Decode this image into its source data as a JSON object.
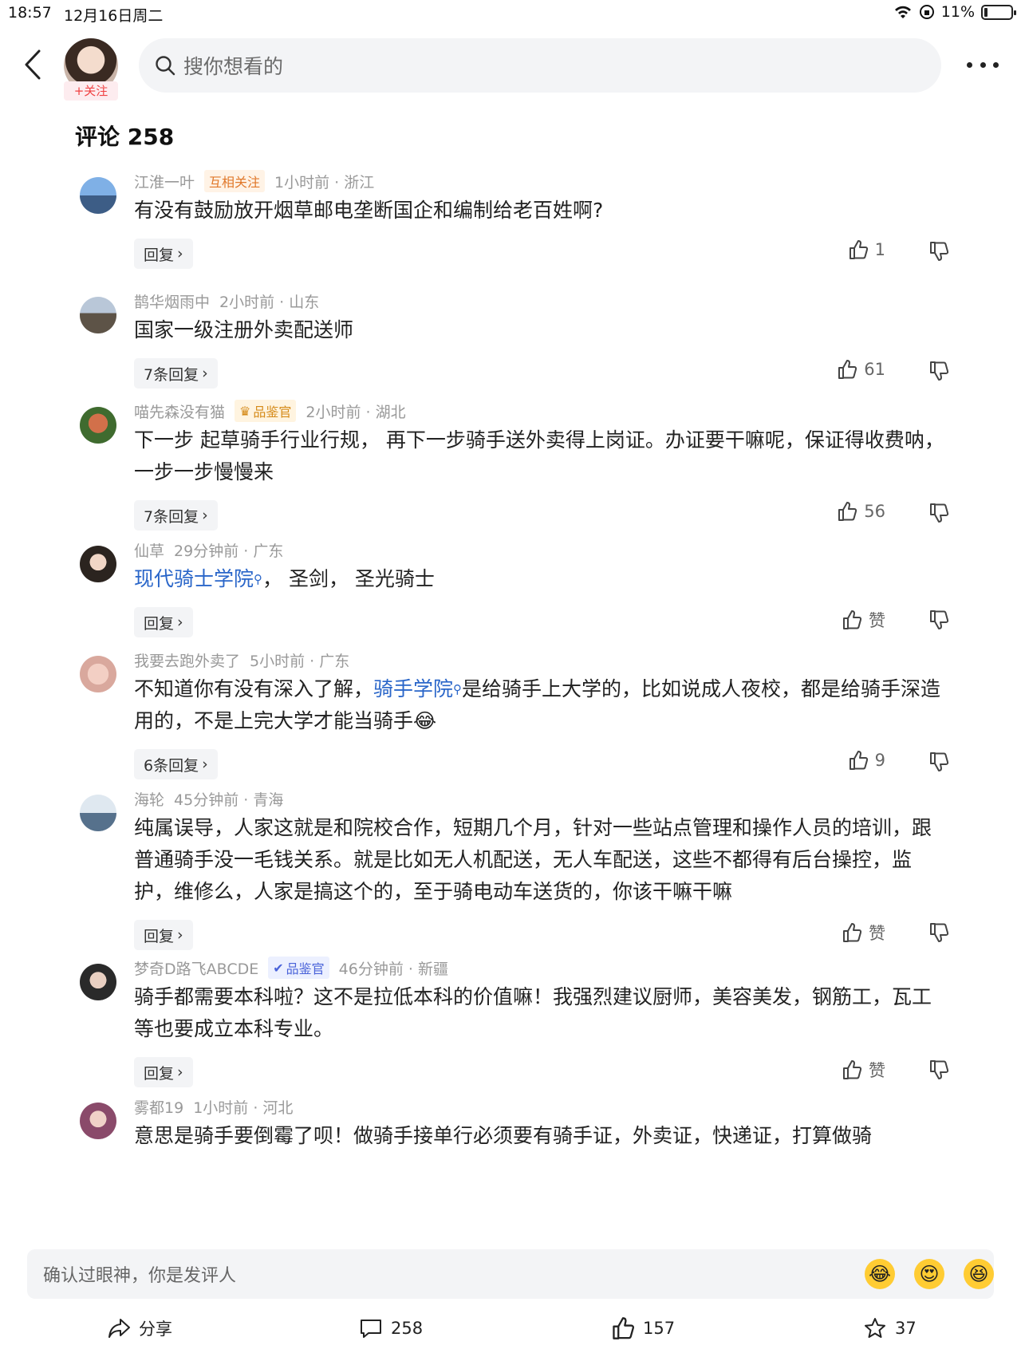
{
  "status": {
    "time": "18:57",
    "date": "12月16日周二",
    "battery": "11%",
    "battery_level": 0.11
  },
  "header": {
    "follow_label": "+关注",
    "search_placeholder": "搜你想看的"
  },
  "comments_title": "评论 258",
  "comments": [
    {
      "user": "江淮一叶",
      "badge": "互相关注",
      "time": "1小时前",
      "loc": "浙江",
      "text": "有没有鼓励放开烟草邮电垄断国企和编制给老百姓啊?",
      "reply": "回复",
      "likes": "1",
      "avatar_color": "#5b86c4"
    },
    {
      "user": "鹊华烟雨中",
      "time": "2小时前",
      "loc": "山东",
      "text": "国家一级注册外卖配送师",
      "reply": "7条回复",
      "likes": "61",
      "avatar_color": "#7d8a9a"
    },
    {
      "user": "喵先森没有猫",
      "badge": "品鉴官",
      "time": "2小时前",
      "loc": "湖北",
      "text": "下一步 起草骑手行业行规， 再下一步骑手送外卖得上岗证。办证要干嘛呢，保证得收费呐， 一步一步慢慢来",
      "reply": "7条回复",
      "likes": "56",
      "avatar_color": "#c98a5a"
    },
    {
      "user": "仙草",
      "time": "29分钟前",
      "loc": "广东",
      "link": "现代骑士学院",
      "text_after": "， 圣剑， 圣光骑士",
      "reply": "回复",
      "likes": "赞",
      "avatar_color": "#3a332c"
    },
    {
      "user": "我要去跑外卖了",
      "time": "5小时前",
      "loc": "广东",
      "text_before": "不知道你有没有深入了解，",
      "link": "骑手学院",
      "text_after": "是给骑手上大学的，比如说成人夜校，都是给骑手深造用的，不是上完大学才能当骑手😂",
      "reply": "6条回复",
      "likes": "9",
      "avatar_color": "#e8c8c0"
    },
    {
      "user": "海轮",
      "time": "45分钟前",
      "loc": "青海",
      "text": "纯属误导，人家这就是和院校合作，短期几个月，针对一些站点管理和操作人员的培训，跟普通骑手没一毛钱关系。就是比如无人机配送，无人车配送，这些不都得有后台操控，监护，维修么，人家是搞这个的，至于骑电动车送货的，你该干嘛干嘛",
      "reply": "回复",
      "likes": "赞",
      "avatar_color": "#8aa7c4"
    },
    {
      "user": "梦奇D路飞ABCDE",
      "badge": "品鉴官",
      "time": "46分钟前",
      "loc": "新疆",
      "text": "骑手都需要本科啦？这不是拉低本科的价值嘛！我强烈建议厨师，美容美发，钢筋工，瓦工等也要成立本科专业。",
      "reply": "回复",
      "likes": "赞",
      "avatar_color": "#4a4a4a"
    },
    {
      "user": "雾都19",
      "time": "1小时前",
      "loc": "河北",
      "text": "意思是骑手要倒霉了呗！做骑手接单行必须要有骑手证，外卖证，快递证，打算做骑",
      "avatar_color": "#b87a9a"
    }
  ],
  "input_placeholder": "确认过眼神，你是发评人",
  "emojis": [
    "😂",
    "😍",
    "😆"
  ],
  "bottom": {
    "share": "分享",
    "comments": "258",
    "likes": "157",
    "favorites": "37"
  }
}
